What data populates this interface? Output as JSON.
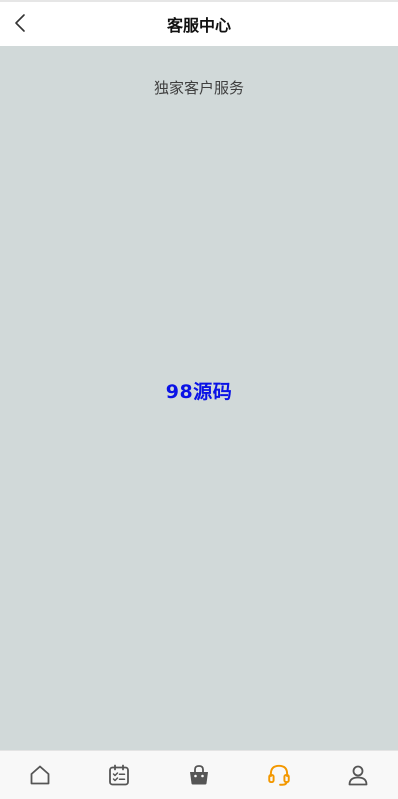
{
  "header": {
    "title": "客服中心",
    "back_icon": "chevron-left-icon"
  },
  "main": {
    "subtitle": "独家客户服务",
    "watermark": "98源码",
    "background_color": "#d1d9d9"
  },
  "tabbar": {
    "active_color": "#f39800",
    "inactive_color": "#555555",
    "tabs": [
      {
        "icon": "home-icon",
        "active": false
      },
      {
        "icon": "calendar-checklist-icon",
        "active": false
      },
      {
        "icon": "shopping-bag-icon",
        "active": false
      },
      {
        "icon": "headset-icon",
        "active": true
      },
      {
        "icon": "user-icon",
        "active": false
      }
    ]
  }
}
